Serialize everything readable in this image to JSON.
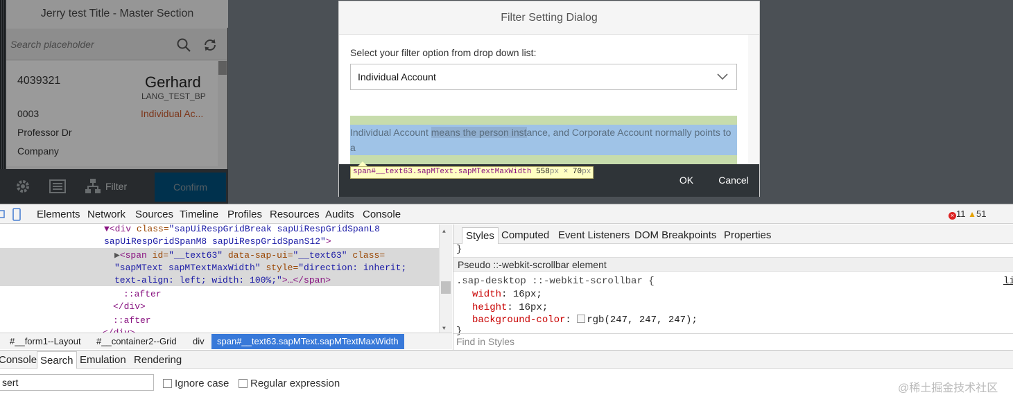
{
  "master": {
    "title": "Jerry test Title - Master Section",
    "search_placeholder": "Search placeholder",
    "item": {
      "id": "4039321",
      "name": "Gerhard",
      "subtitle": "LANG_TEST_BP",
      "code": "0003",
      "status": "Individual Ac...",
      "attr1": "Professor Dr",
      "attr2": "Company"
    },
    "footer": {
      "filter_label": "Filter",
      "confirm_label": "Confirm"
    }
  },
  "dialog": {
    "title": "Filter Setting Dialog",
    "select_label": "Select your filter option from drop down list:",
    "select_value": "Individual Account",
    "text_pre": "Individual Account ",
    "text_sel": "means the person inst",
    "text_post": "ance, and Corporate Account normally points to a",
    "ok_label": "OK",
    "cancel_label": "Cancel"
  },
  "tooltip": {
    "selector": "span#__text63.sapMText.sapMTextMaxWidth",
    "width": "558",
    "height": "70",
    "unit": "px",
    "times": "×"
  },
  "devtools": {
    "tabs": [
      "Elements",
      "Network",
      "Sources",
      "Timeline",
      "Profiles",
      "Resources",
      "Audits",
      "Console"
    ],
    "errors": "11",
    "warnings": "51",
    "dom": {
      "l1_tag": "▼<div",
      "l1_attr": " class=",
      "l1_val": "\"sapUiRespGridBreak sapUiRespGridSpanL8",
      "l2_val": "sapUiRespGridSpanM8 sapUiRespGridSpanS12\"",
      "l2_end": ">",
      "l3_tri": "▶",
      "l3_tag": "<span",
      "l3_a1": " id=",
      "l3_v1": "\"__text63\"",
      "l3_a2": " data-sap-ui=",
      "l3_v2": "\"__text63\"",
      "l3_a3": " class=",
      "l4_v3": "\"sapMText sapMTextMaxWidth\"",
      "l4_a4": " style=",
      "l4_v4": "\"direction: inherit;",
      "l5_v4": "text-align: left; width: 100%;\"",
      "l5_end": ">…</span>",
      "l6": "::after",
      "l7": "</div>",
      "l8": "::after",
      "l9": "</div>"
    },
    "breadcrumbs": [
      "#__form1--Layout",
      "#__container2--Grid",
      "div"
    ],
    "breadcrumb_active": "span#__text63.sapMText.sapMTextMaxWidth",
    "styles_tabs": [
      "Styles",
      "Computed",
      "Event Listeners",
      "DOM Breakpoints",
      "Properties"
    ],
    "styles_brace_top": "}",
    "pseudo_header": "Pseudo ::-webkit-scrollbar element",
    "rule_selector": ".sap-desktop ::-webkit-scrollbar {",
    "rule_link": "li",
    "props": [
      {
        "name": "width",
        "value": "16px;"
      },
      {
        "name": "height",
        "value": "16px;"
      },
      {
        "name": "background-color",
        "value": "rgb(247, 247, 247);"
      }
    ],
    "brace_close": "}",
    "find_placeholder": "Find in Styles",
    "drawer_tabs": [
      "Console",
      "Search",
      "Emulation",
      "Rendering"
    ],
    "search_value": "sert",
    "ignore_case": "Ignore case",
    "regex": "Regular expression"
  },
  "watermark": "@稀土掘金技术社区",
  "colors": {
    "confirm_blue": "#007cc0",
    "highlight_content": "#9fc3e7",
    "highlight_padding": "#c7dcac",
    "breadcrumb_active": "#3879d9"
  }
}
